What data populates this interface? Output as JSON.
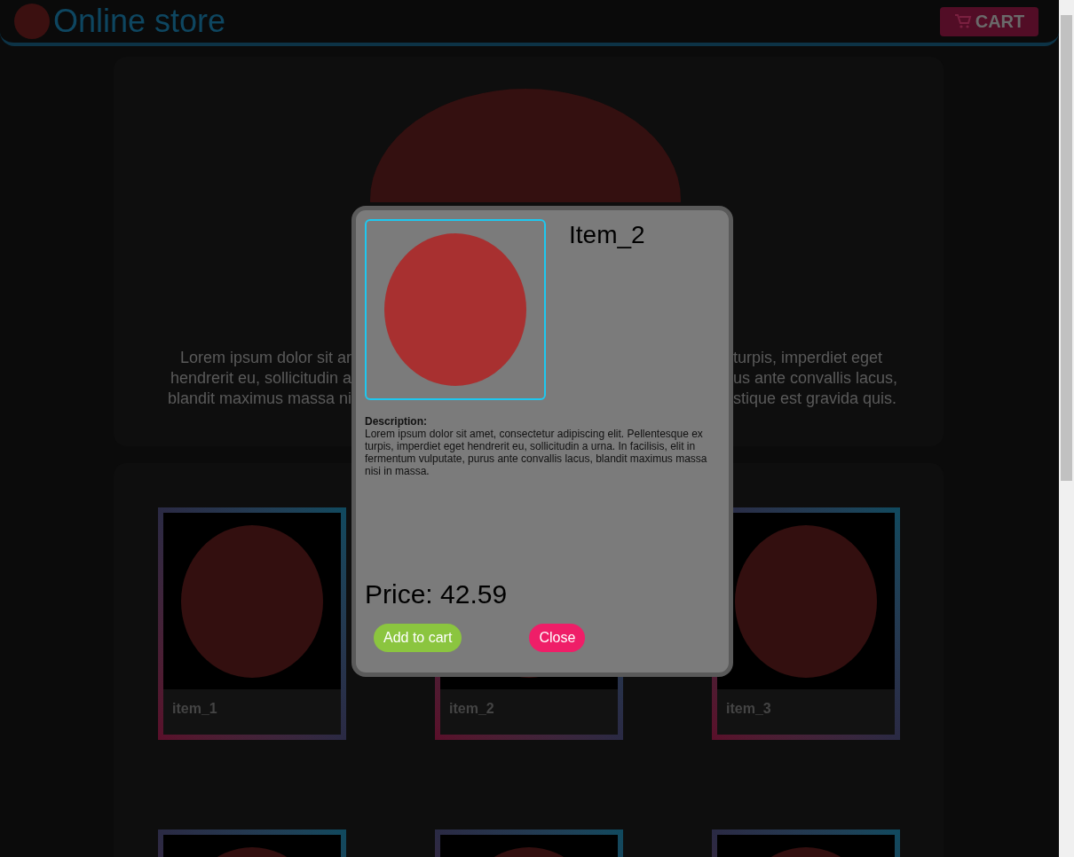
{
  "header": {
    "title": "Online store",
    "cart_label": "CART"
  },
  "hero": {
    "text_left": [
      "Lorem ipsum dolor sit ar",
      "hendrerit eu, sollicitudin a",
      "blandit maximus massa ni"
    ],
    "text_right": [
      "turpis, imperdiet eget",
      "us ante convallis lacus,",
      "stique est gravida quis."
    ]
  },
  "products": [
    {
      "kind": "card",
      "label": "item_1"
    },
    {
      "kind": "card",
      "label": "item_2"
    },
    {
      "kind": "card",
      "label": "item_3"
    },
    {
      "kind": "picture"
    },
    {
      "kind": "picture"
    },
    {
      "kind": "picture"
    }
  ],
  "modal": {
    "title": "Item_2",
    "description_heading": "Description:",
    "description": "Lorem ipsum dolor sit amet, consectetur adipiscing elit. Pellentesque ex turpis, imperdiet eget hendrerit eu, sollicitudin a urna. In facilisis, elit in fermentum vulputate, purus ante convallis lacus, blandit maximus massa nisi in massa.",
    "price": "Price: 42.59",
    "buttons": [
      {
        "label": "Add to cart",
        "kind": "add"
      },
      {
        "label": "Close",
        "kind": "close"
      }
    ]
  }
}
